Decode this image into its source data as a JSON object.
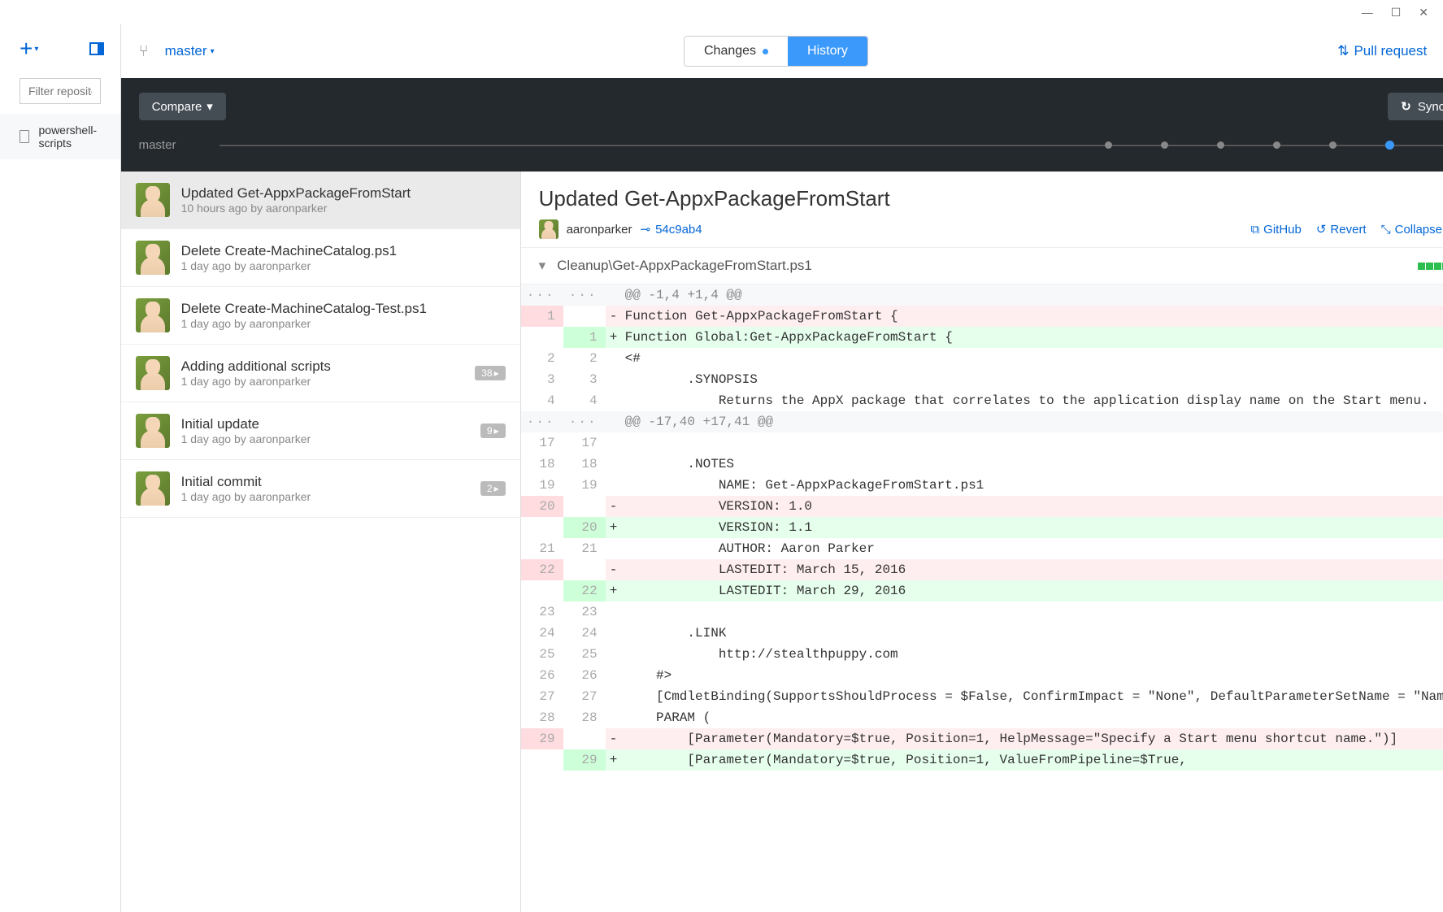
{
  "titlebar": {
    "minimize": "min",
    "maximize": "max",
    "close": "close"
  },
  "sidebar": {
    "filter_placeholder": "Filter repositories",
    "repo": "powershell-scripts"
  },
  "topbar": {
    "branch": "master",
    "tab_changes": "Changes",
    "tab_history": "History",
    "pull_request": "Pull request"
  },
  "compare": {
    "button": "Compare",
    "sync": "Sync",
    "timeline_label": "master"
  },
  "commits": [
    {
      "title": "Updated Get-AppxPackageFromStart",
      "meta": "10 hours ago by aaronparker",
      "selected": true
    },
    {
      "title": "Delete Create-MachineCatalog.ps1",
      "meta": "1 day ago by aaronparker"
    },
    {
      "title": "Delete Create-MachineCatalog-Test.ps1",
      "meta": "1 day ago by aaronparker"
    },
    {
      "title": "Adding additional scripts",
      "meta": "1 day ago by aaronparker",
      "badge": "38"
    },
    {
      "title": "Initial update",
      "meta": "1 day ago by aaronparker",
      "badge": "9"
    },
    {
      "title": "Initial commit",
      "meta": "1 day ago by aaronparker",
      "badge": "2"
    }
  ],
  "diff": {
    "title": "Updated Get-AppxPackageFromStart",
    "author": "aaronparker",
    "sha": "54c9ab4",
    "action_github": "GitHub",
    "action_revert": "Revert",
    "action_collapse": "Collapse all",
    "file": "Cleanup\\Get-AppxPackageFromStart.ps1",
    "lines": [
      {
        "t": "hunk",
        "o": "···",
        "n": "···",
        "m": "",
        "c": "@@ -1,4 +1,4 @@"
      },
      {
        "t": "del",
        "o": "1",
        "n": "",
        "m": "-",
        "c": "Function Get-AppxPackageFromStart {"
      },
      {
        "t": "add",
        "o": "",
        "n": "1",
        "m": "+",
        "c": "Function Global:Get-AppxPackageFromStart {"
      },
      {
        "t": "ctx",
        "o": "2",
        "n": "2",
        "m": "",
        "c": "<#"
      },
      {
        "t": "ctx",
        "o": "3",
        "n": "3",
        "m": "",
        "c": "        .SYNOPSIS"
      },
      {
        "t": "ctx",
        "o": "4",
        "n": "4",
        "m": "",
        "c": "            Returns the AppX package that correlates to the application display name on the Start menu."
      },
      {
        "t": "hunk",
        "o": "···",
        "n": "···",
        "m": "",
        "c": "@@ -17,40 +17,41 @@"
      },
      {
        "t": "ctx",
        "o": "17",
        "n": "17",
        "m": "",
        "c": ""
      },
      {
        "t": "ctx",
        "o": "18",
        "n": "18",
        "m": "",
        "c": "        .NOTES"
      },
      {
        "t": "ctx",
        "o": "19",
        "n": "19",
        "m": "",
        "c": "            NAME: Get-AppxPackageFromStart.ps1"
      },
      {
        "t": "del",
        "o": "20",
        "n": "",
        "m": "-",
        "c": "            VERSION: 1.0"
      },
      {
        "t": "add",
        "o": "",
        "n": "20",
        "m": "+",
        "c": "            VERSION: 1.1"
      },
      {
        "t": "ctx",
        "o": "21",
        "n": "21",
        "m": "",
        "c": "            AUTHOR: Aaron Parker"
      },
      {
        "t": "del",
        "o": "22",
        "n": "",
        "m": "-",
        "c": "            LASTEDIT: March 15, 2016"
      },
      {
        "t": "add",
        "o": "",
        "n": "22",
        "m": "+",
        "c": "            LASTEDIT: March 29, 2016"
      },
      {
        "t": "ctx",
        "o": "23",
        "n": "23",
        "m": "",
        "c": ""
      },
      {
        "t": "ctx",
        "o": "24",
        "n": "24",
        "m": "",
        "c": "        .LINK"
      },
      {
        "t": "ctx",
        "o": "25",
        "n": "25",
        "m": "",
        "c": "            http://stealthpuppy.com"
      },
      {
        "t": "ctx",
        "o": "26",
        "n": "26",
        "m": "",
        "c": "    #>"
      },
      {
        "t": "ctx",
        "o": "27",
        "n": "27",
        "m": "",
        "c": "    [CmdletBinding(SupportsShouldProcess = $False, ConfirmImpact = \"None\", DefaultParameterSetName = \"Name\")]"
      },
      {
        "t": "ctx",
        "o": "28",
        "n": "28",
        "m": "",
        "c": "    PARAM ("
      },
      {
        "t": "del",
        "o": "29",
        "n": "",
        "m": "-",
        "c": "        [Parameter(Mandatory=$true, Position=1, HelpMessage=\"Specify a Start menu shortcut name.\")]"
      },
      {
        "t": "add",
        "o": "",
        "n": "29",
        "m": "+",
        "c": "        [Parameter(Mandatory=$true, Position=1, ValueFromPipeline=$True,"
      }
    ]
  }
}
